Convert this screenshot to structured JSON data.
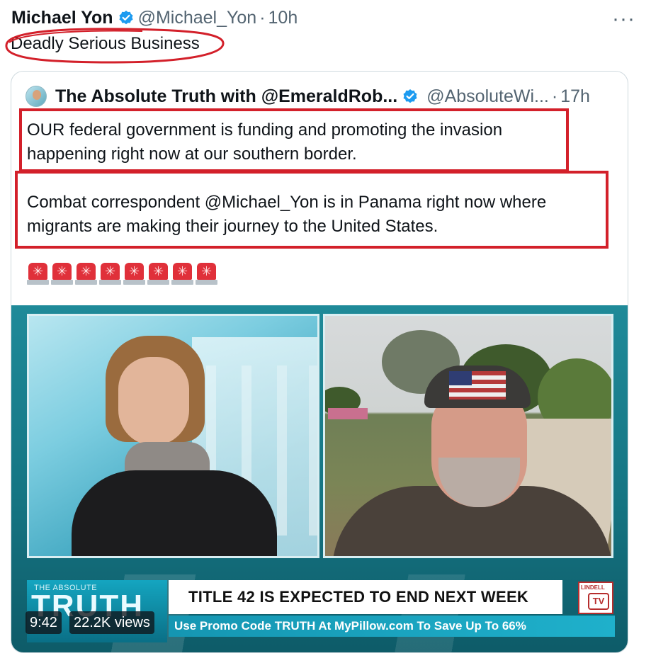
{
  "post": {
    "author_name": "Michael Yon",
    "author_handle": "@Michael_Yon",
    "separator": "·",
    "time": "10h",
    "text": "Deadly Serious Business",
    "more_icon": "more-horizontal-icon"
  },
  "quoted": {
    "author_name": "The Absolute Truth with @EmeraldRob...",
    "author_handle": "@AbsoluteWi...",
    "separator": "·",
    "time": "17h",
    "paragraph1": "OUR federal government is funding and promoting the invasion happening right now at our southern border.",
    "paragraph2": "Combat correspondent @Michael_Yon is in Panama right now where migrants are making their journey to the United States.",
    "emoji_count": 8,
    "emoji_icon": "police-siren-icon"
  },
  "video": {
    "brand_small": "THE ABSOLUTE",
    "brand_big": "TRUTH",
    "headline": "TITLE 42 IS EXPECTED TO END NEXT WEEK",
    "ticker": "Use Promo Code TRUTH At MyPillow.com To Save Up To 66%",
    "tv_logo_top": "LINDELL",
    "tv_logo_main": "TV",
    "duration": "9:42",
    "views": "22.2K views"
  },
  "colors": {
    "annotation_red": "#d3202a",
    "verified_blue": "#1d9bf0",
    "video_teal": "#157583"
  }
}
